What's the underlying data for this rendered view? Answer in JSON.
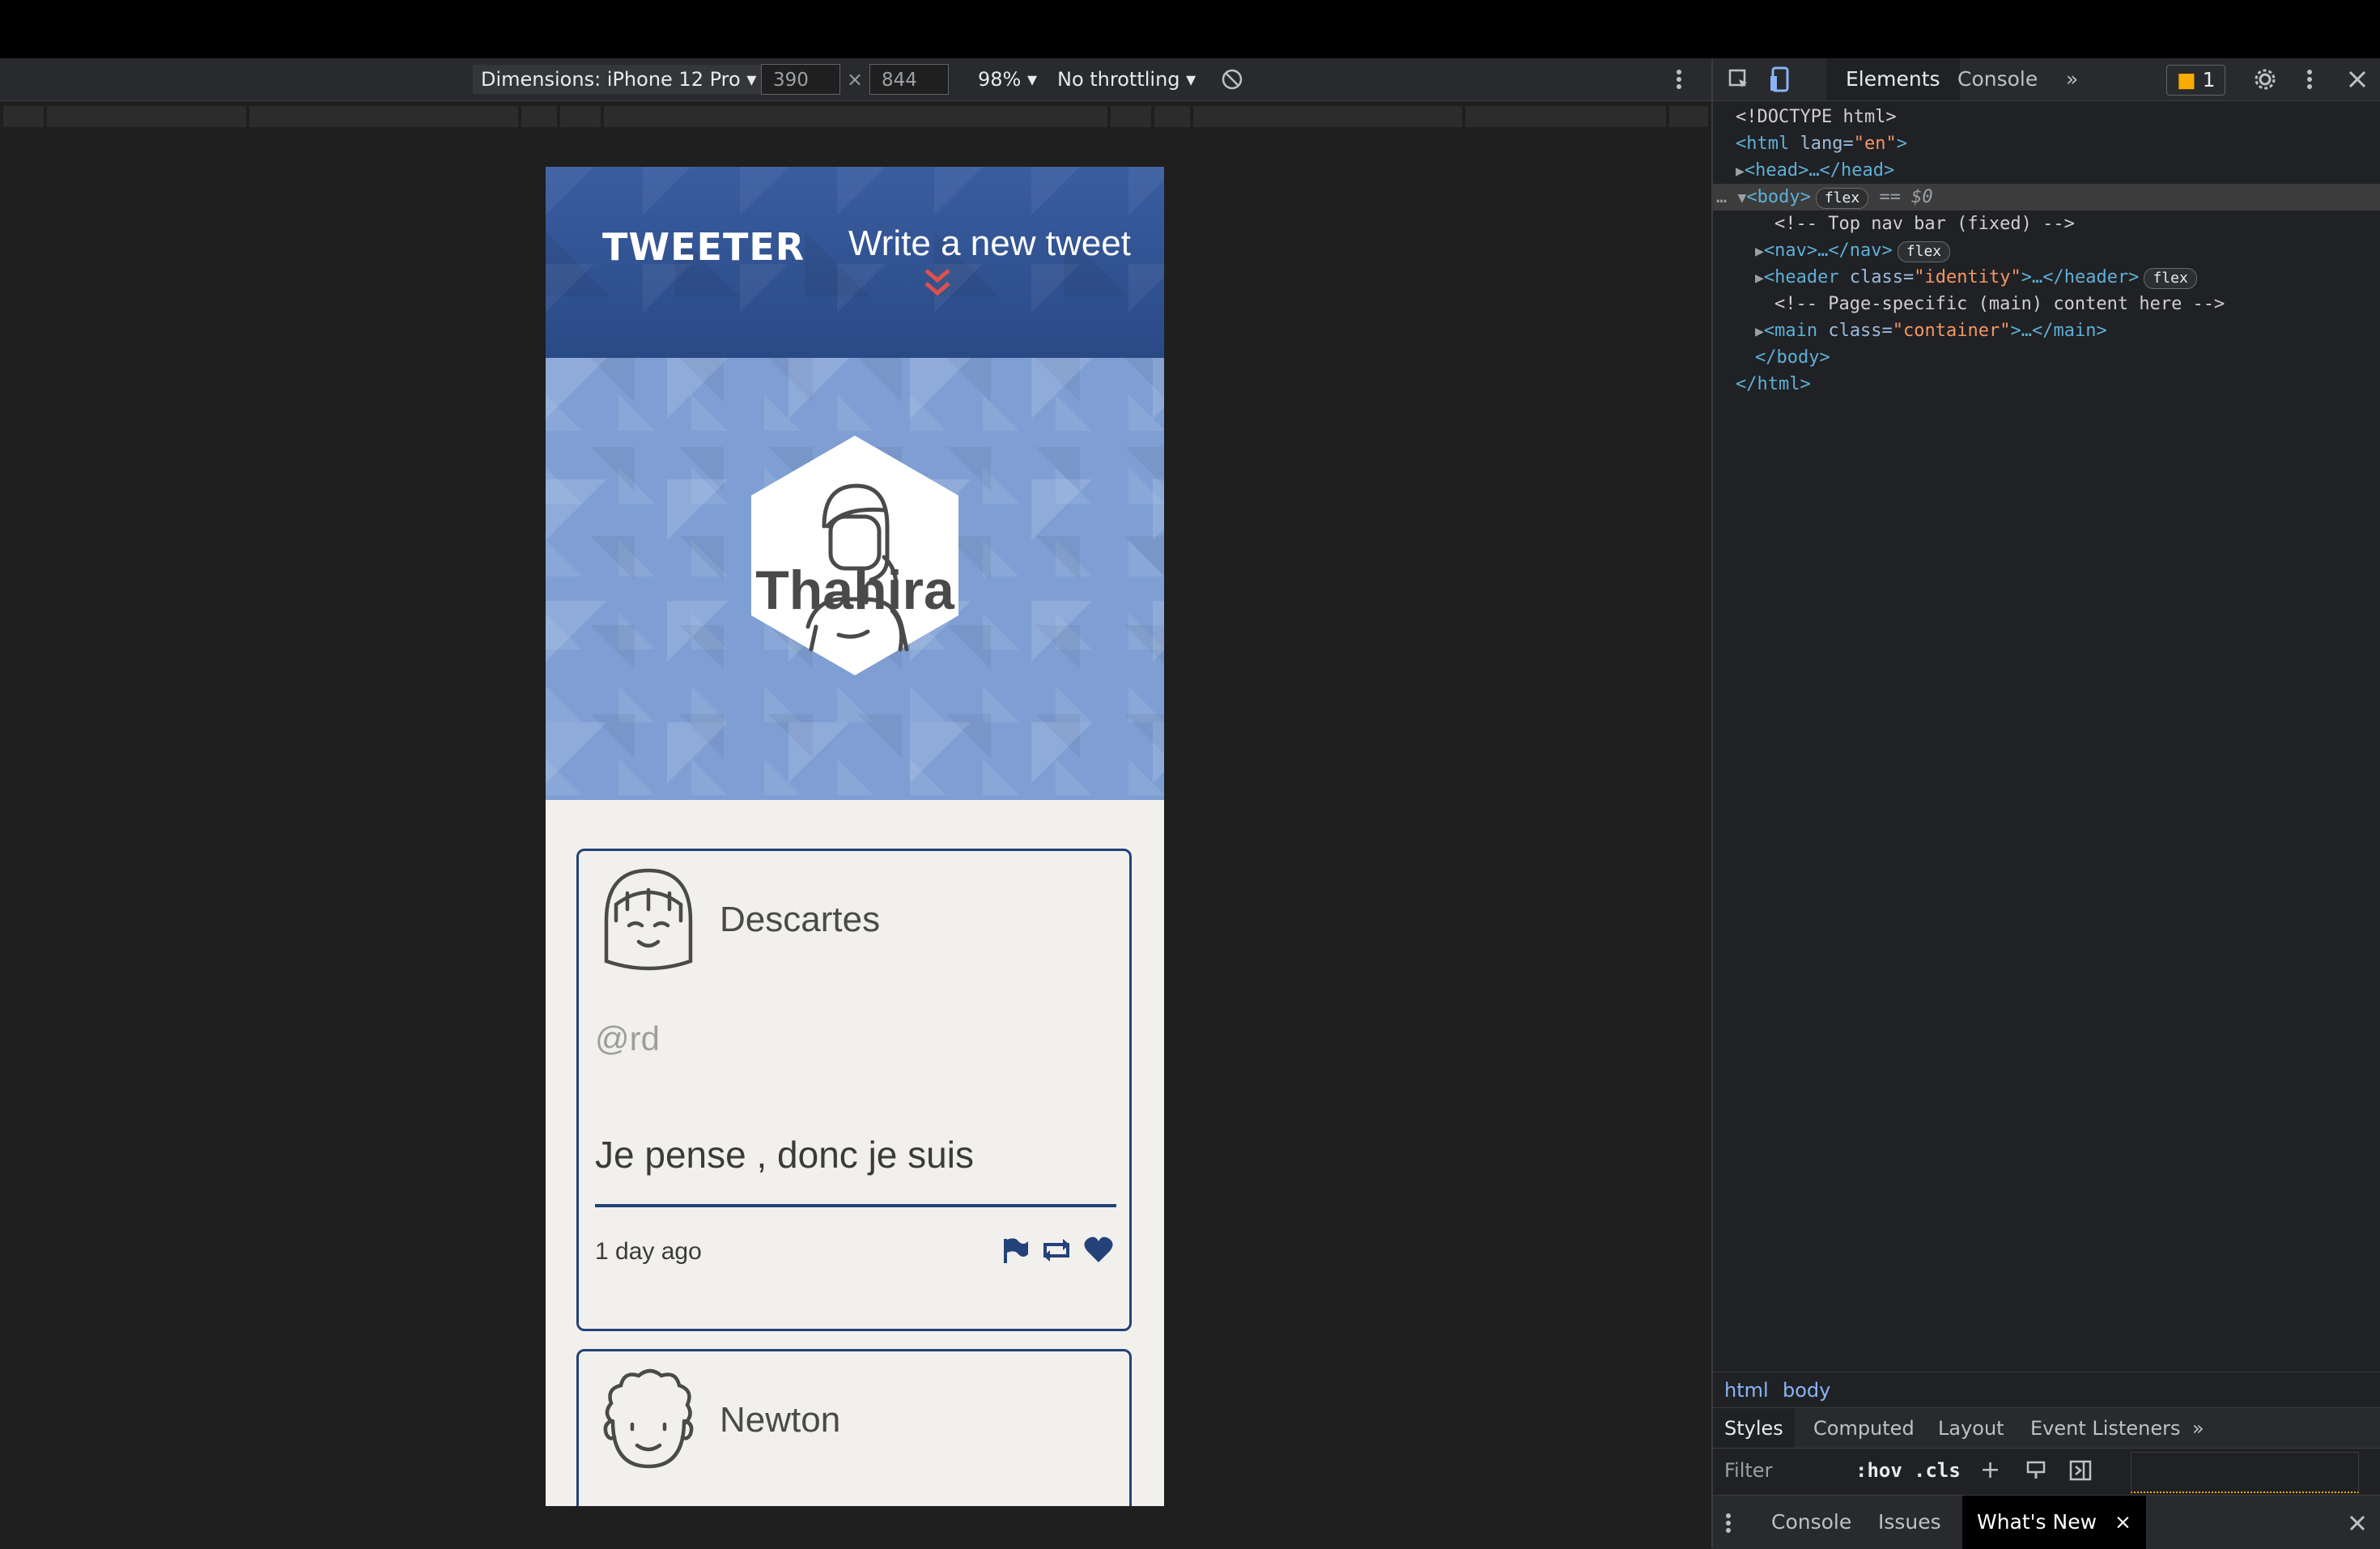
{
  "device_toolbar": {
    "dimensions_label": "Dimensions: iPhone 12 Pro",
    "width_value": "390",
    "times": "×",
    "height_value": "844",
    "zoom": "98%",
    "throttling": "No throttling",
    "caret": "▾"
  },
  "app": {
    "logo": "TWEETER",
    "compose_label": "Write a new tweet",
    "profile_name": "Thahira",
    "tweets": [
      {
        "name": "Descartes",
        "handle": "@rd",
        "text": "Je pense , donc je suis",
        "time": "1 day ago"
      },
      {
        "name": "Newton"
      }
    ]
  },
  "devtools": {
    "tabs": [
      "Elements",
      "Console"
    ],
    "more": "»",
    "issues_count": "1",
    "dom": {
      "doctype": "<!DOCTYPE html>",
      "html_open": "<html",
      "lang_attr": " lang=",
      "lang_val": "\"en\"",
      "gt": ">",
      "head": "<head>…</head>",
      "body_open": "<body>",
      "body_badge": "flex",
      "body_eq": "== $0",
      "comment_nav": "<!-- Top nav bar (fixed) -->",
      "nav": "<nav>…</nav>",
      "nav_badge": "flex",
      "header_open": "<header",
      "class_attr": " class=",
      "header_class": "\"identity\"",
      "header_rest": ">…</header>",
      "header_badge": "flex",
      "comment_main": "<!-- Page-specific (main) content here -->",
      "main_open": "<main",
      "main_class": "\"container\"",
      "main_rest": ">…</main>",
      "body_close": "</body>",
      "html_close": "</html>"
    },
    "breadcrumbs": [
      "html",
      "body"
    ],
    "style_tabs": [
      "Styles",
      "Computed",
      "Layout",
      "Event Listeners",
      "»"
    ],
    "filter_placeholder": "Filter",
    "hov": ":hov",
    "cls": ".cls",
    "drawer_tabs": [
      "Console",
      "Issues",
      "What's New"
    ],
    "close": "×"
  }
}
